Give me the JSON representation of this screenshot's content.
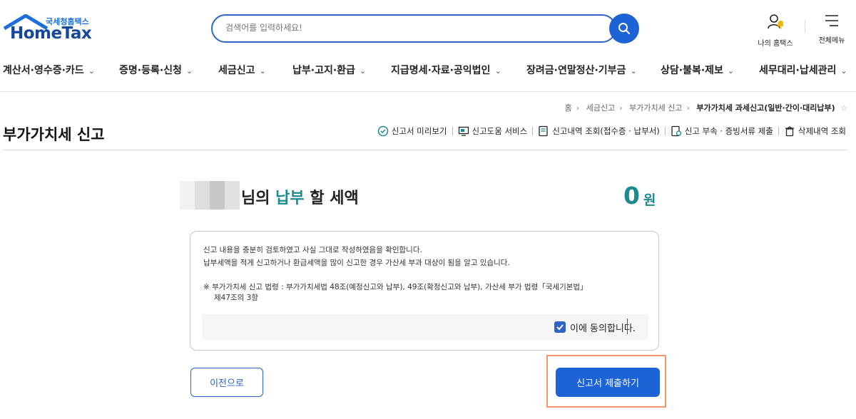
{
  "header": {
    "brand_ko": "국세청홈택스",
    "brand_en": "HomeTax",
    "search_placeholder": "검색어를 입력하세요!",
    "my_hometax": "나의 홈택스",
    "all_menu": "전체메뉴"
  },
  "gnb": [
    {
      "label": "계산서·영수증·카드",
      "icon": "chevron-down-icon"
    },
    {
      "label": "증명·등록·신청",
      "icon": "chevron-down-icon"
    },
    {
      "label": "세금신고",
      "icon": "chevron-down-icon"
    },
    {
      "label": "납부·고지·환급",
      "icon": "chevron-down-icon"
    },
    {
      "label": "지급명세·자료·공익법인",
      "icon": "chevron-down-icon"
    },
    {
      "label": "장려금·연말정산·기부금",
      "icon": "chevron-down-icon"
    },
    {
      "label": "상담·불복·제보",
      "icon": "chevron-down-icon"
    },
    {
      "label": "세무대리·납세관리",
      "icon": "chevron-down-icon"
    }
  ],
  "breadcrumb": [
    "홈",
    "세금신고",
    "부가가치세 신고",
    "부가가치세 과세신고(일반·간이·대리납부)"
  ],
  "page_title": "부가가치세 신고",
  "toolbar": [
    {
      "label": "신고서 미리보기",
      "icon": "preview-icon"
    },
    {
      "label": "신고도움 서비스",
      "icon": "help-monitor-icon"
    },
    {
      "label": "신고내역 조회(접수증 · 납부서)",
      "icon": "history-icon"
    },
    {
      "label": "신고 부속 · 증빙서류 제출",
      "icon": "document-upload-icon"
    },
    {
      "label": "삭제내역 조회",
      "icon": "trash-icon"
    }
  ],
  "summary": {
    "prefix": "님의",
    "keyword": "납부",
    "suffix": "할 세액",
    "amount": "0",
    "unit": "원"
  },
  "notice": {
    "line1": "신고 내용을 충분히 검토하였고 사실 그대로 작성하였음을 확인합니다.",
    "line2": "납부세액을 적게 신고하거나 환급세액을 많이 신고한 경우 가산세 부과 대상이 됨을 알고 있습니다.",
    "law1": "※ 부가가치세 신고 법령 :  부가가치세법 48조(예정신고와 납부), 49조(확정신고와 납부), 가산세 부가 법령「국세기본법」",
    "law2": "제47조의 3항",
    "agree_label": "이에 동의합니다.",
    "agree_checked": true
  },
  "buttons": {
    "prev": "이전으로",
    "submit": "신고서 제출하기"
  },
  "colors": {
    "primary": "#1e63d6",
    "accent": "#1c8a8e",
    "highlight": "#f0986a"
  }
}
